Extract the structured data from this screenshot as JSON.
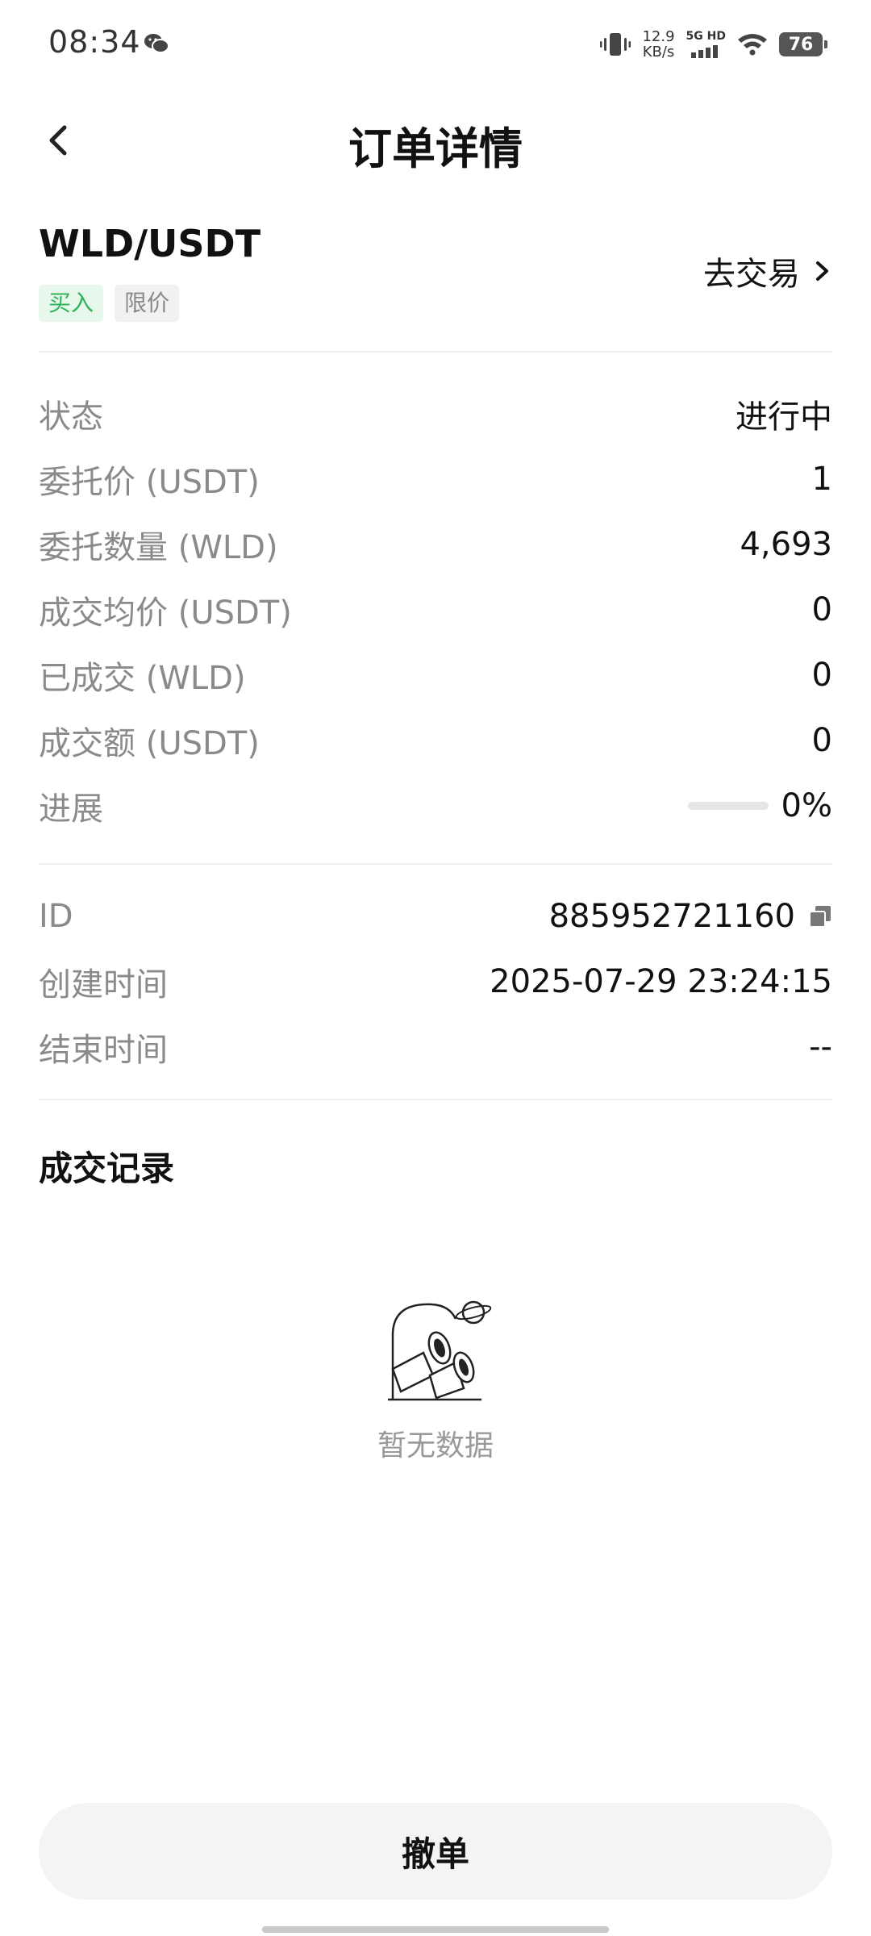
{
  "status_bar": {
    "time": "08:34",
    "net_speed_value": "12.9",
    "net_speed_unit": "KB/s",
    "signal_label": "5G HD",
    "battery": "76"
  },
  "header": {
    "title": "订单详情"
  },
  "pair": {
    "name": "WLD/USDT",
    "side_tag": "买入",
    "type_tag": "限价",
    "trade_link": "去交易"
  },
  "details": [
    {
      "label": "状态",
      "value": "进行中"
    },
    {
      "label": "委托价 (USDT)",
      "value": "1"
    },
    {
      "label": "委托数量 (WLD)",
      "value": "4,693"
    },
    {
      "label": "成交均价 (USDT)",
      "value": "0"
    },
    {
      "label": "已成交 (WLD)",
      "value": "0"
    },
    {
      "label": "成交额 (USDT)",
      "value": "0"
    },
    {
      "label": "进展",
      "value": "0%"
    }
  ],
  "progress": 0,
  "meta": [
    {
      "label": "ID",
      "value": "885952721160"
    },
    {
      "label": "创建时间",
      "value": "2025-07-29 23:24:15"
    },
    {
      "label": "结束时间",
      "value": "--"
    }
  ],
  "trades": {
    "title": "成交记录",
    "empty_text": "暂无数据"
  },
  "cancel_button": "撤单",
  "colors": {
    "buy": "#2fb45a",
    "buy_bg": "#e8f7ec",
    "label": "#8a8a8a"
  }
}
